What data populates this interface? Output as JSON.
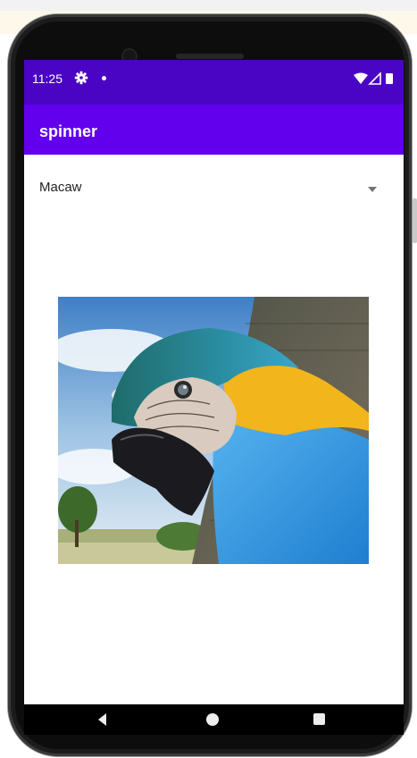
{
  "status_bar": {
    "time": "11:25",
    "icons": [
      "settings-icon",
      "notification-dot-icon",
      "wifi-icon",
      "signal-icon",
      "battery-icon"
    ]
  },
  "app_bar": {
    "title": "spinner"
  },
  "spinner": {
    "selected": "Macaw",
    "icon": "dropdown-arrow-icon"
  },
  "image": {
    "subject": "blue-and-yellow macaw"
  },
  "nav_bar": {
    "icons": [
      "back-icon",
      "home-icon",
      "recents-icon"
    ]
  },
  "colors": {
    "status_bar": "#4a05c4",
    "app_bar": "#6200ee"
  }
}
